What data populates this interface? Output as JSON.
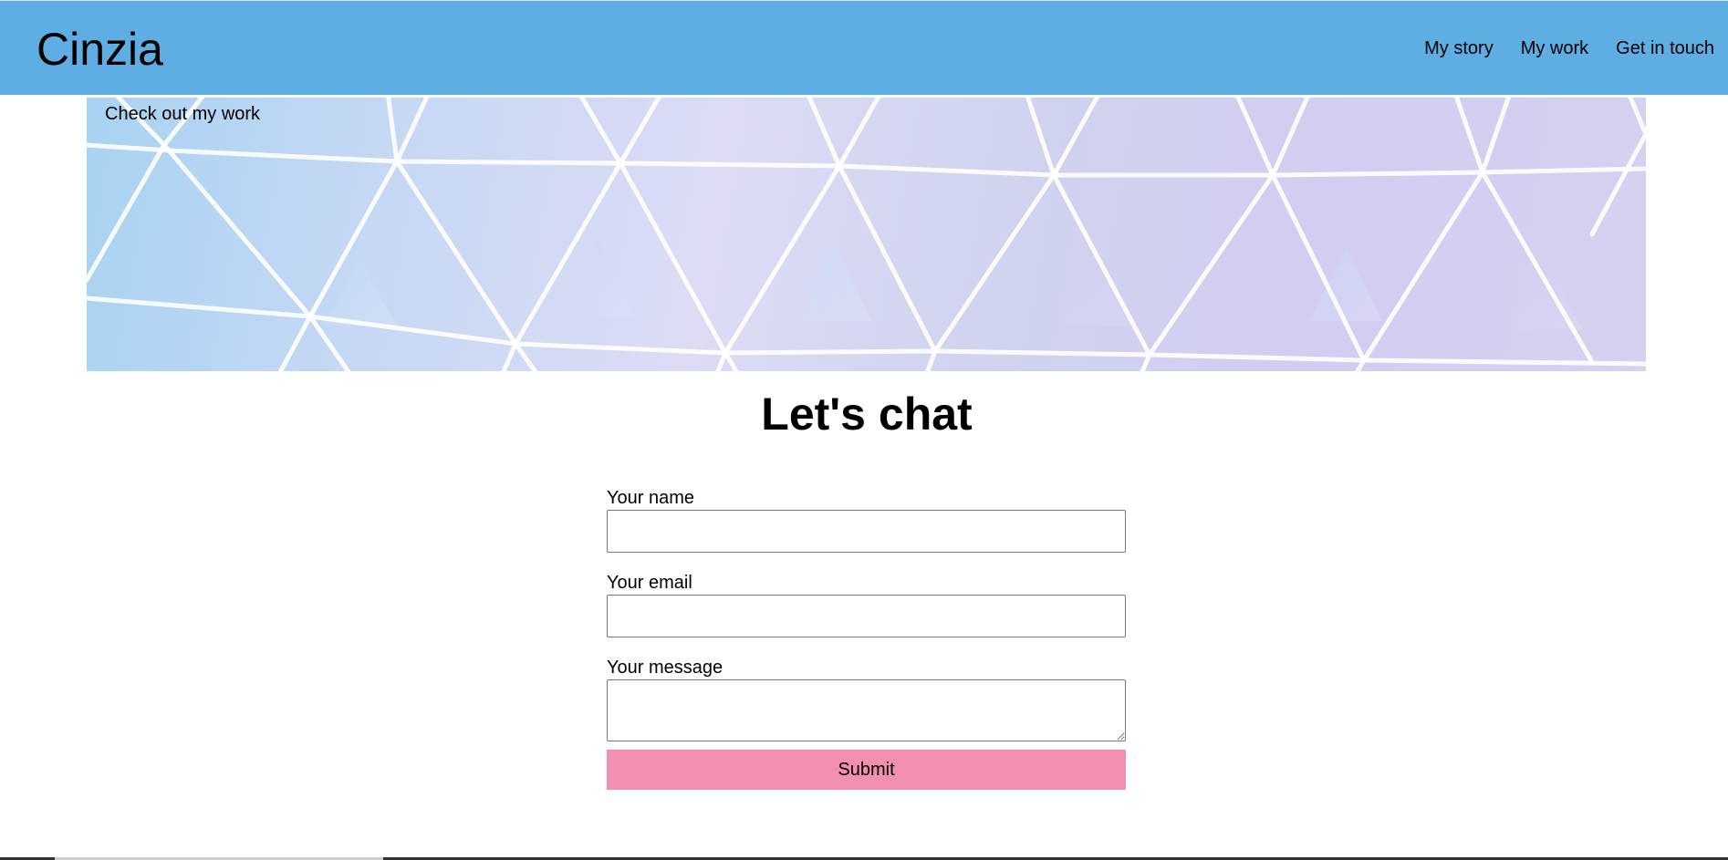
{
  "header": {
    "logo": "Cinzia",
    "nav": [
      {
        "label": "My story"
      },
      {
        "label": "My work"
      },
      {
        "label": "Get in touch"
      }
    ],
    "background_color": "#5eade3"
  },
  "hero": {
    "link_label": "Check out my work",
    "image": "geodesic-dome-triangles-pastel"
  },
  "main": {
    "title": "Let's chat"
  },
  "form": {
    "name_label": "Your name",
    "name_value": "",
    "email_label": "Your email",
    "email_value": "",
    "message_label": "Your message",
    "message_value": "",
    "submit_label": "Submit",
    "submit_color": "#f38fb0"
  }
}
